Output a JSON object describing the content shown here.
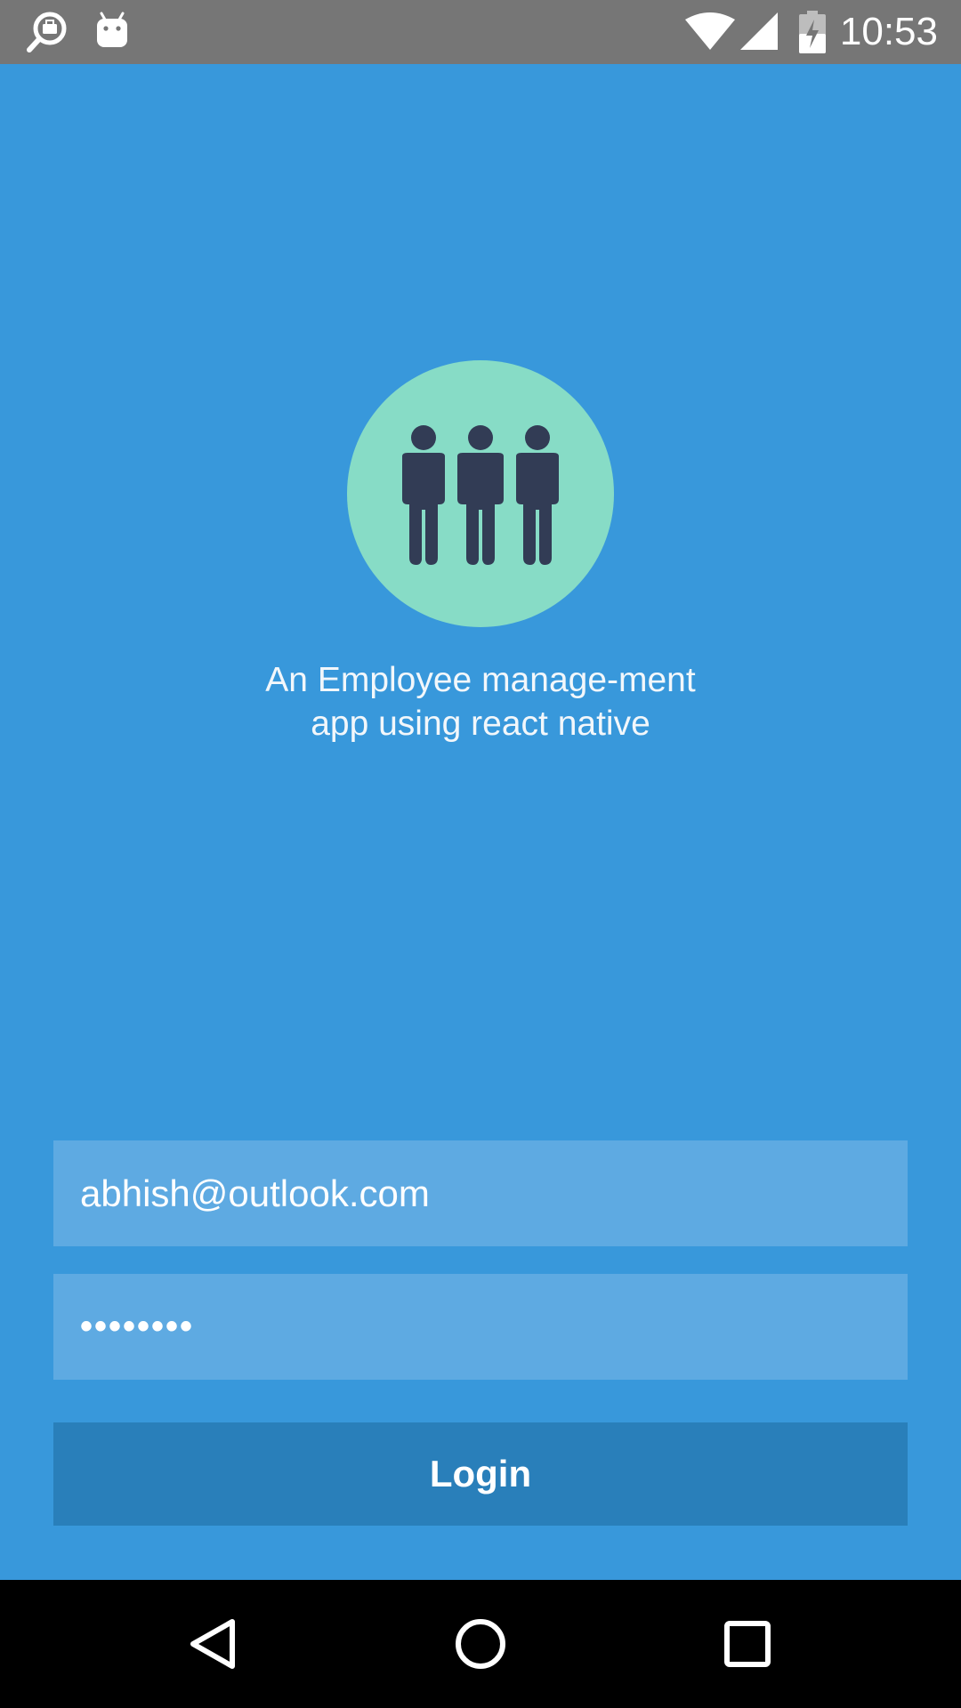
{
  "status_bar": {
    "time": "10:53",
    "icons": [
      "search-briefcase-icon",
      "android-icon",
      "wifi-icon",
      "signal-icon",
      "battery-charging-icon"
    ]
  },
  "branding": {
    "logo_icon": "people-group-icon",
    "tagline": "An Employee manage-ment app using react native"
  },
  "form": {
    "email_value": "abhish@outlook.com",
    "password_value": "••••••••",
    "login_label": "Login"
  },
  "nav_bar": {
    "buttons": [
      "back-icon",
      "home-icon",
      "recents-icon"
    ]
  },
  "colors": {
    "background": "#3898db",
    "input_bg": "#5eaae2",
    "button_bg": "#297fba",
    "logo_circle": "#87dcc6",
    "figure": "#323c55"
  }
}
